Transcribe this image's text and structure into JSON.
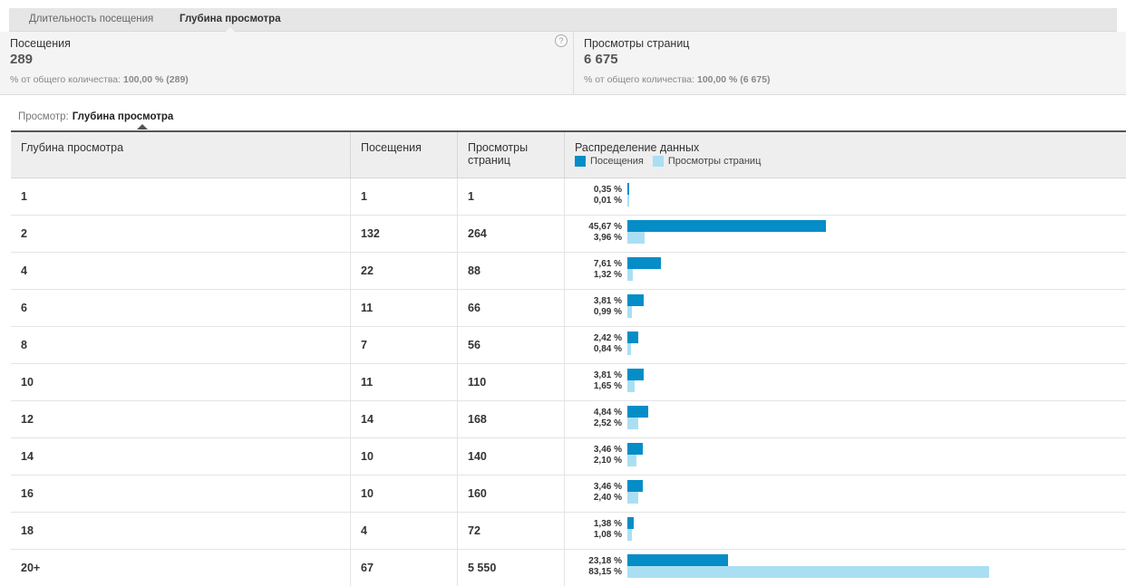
{
  "tabs": [
    {
      "label": "Длительность посещения"
    },
    {
      "label": "Глубина просмотра"
    }
  ],
  "scorecards": [
    {
      "title": "Посещения",
      "value": "289",
      "sub_prefix": "% от общего количества: ",
      "sub_value": "100,00 % (289)"
    },
    {
      "title": "Просмотры страниц",
      "value": "6 675",
      "sub_prefix": "% от общего количества: ",
      "sub_value": "100,00 % (6 675)"
    }
  ],
  "view": {
    "label": "Просмотр:",
    "value": "Глубина просмотра"
  },
  "table": {
    "headers": [
      "Глубина просмотра",
      "Посещения",
      "Просмотры страниц",
      "Распределение данных"
    ],
    "legend": [
      {
        "label": "Посещения",
        "color": "#058dc7"
      },
      {
        "label": "Просмотры страниц",
        "color": "#aadff3"
      }
    ],
    "rows": [
      {
        "depth": "1",
        "visits": "1",
        "views": "1",
        "visits_pct": "0,35 %",
        "views_pct": "0,01 %",
        "visits_share": 0.35,
        "views_share": 0.01
      },
      {
        "depth": "2",
        "visits": "132",
        "views": "264",
        "visits_pct": "45,67 %",
        "views_pct": "3,96 %",
        "visits_share": 45.67,
        "views_share": 3.96
      },
      {
        "depth": "4",
        "visits": "22",
        "views": "88",
        "visits_pct": "7,61 %",
        "views_pct": "1,32 %",
        "visits_share": 7.61,
        "views_share": 1.32
      },
      {
        "depth": "6",
        "visits": "11",
        "views": "66",
        "visits_pct": "3,81 %",
        "views_pct": "0,99 %",
        "visits_share": 3.81,
        "views_share": 0.99
      },
      {
        "depth": "8",
        "visits": "7",
        "views": "56",
        "visits_pct": "2,42 %",
        "views_pct": "0,84 %",
        "visits_share": 2.42,
        "views_share": 0.84
      },
      {
        "depth": "10",
        "visits": "11",
        "views": "110",
        "visits_pct": "3,81 %",
        "views_pct": "1,65 %",
        "visits_share": 3.81,
        "views_share": 1.65
      },
      {
        "depth": "12",
        "visits": "14",
        "views": "168",
        "visits_pct": "4,84 %",
        "views_pct": "2,52 %",
        "visits_share": 4.84,
        "views_share": 2.52
      },
      {
        "depth": "14",
        "visits": "10",
        "views": "140",
        "visits_pct": "3,46 %",
        "views_pct": "2,10 %",
        "visits_share": 3.46,
        "views_share": 2.1
      },
      {
        "depth": "16",
        "visits": "10",
        "views": "160",
        "visits_pct": "3,46 %",
        "views_pct": "2,40 %",
        "visits_share": 3.46,
        "views_share": 2.4
      },
      {
        "depth": "18",
        "visits": "4",
        "views": "72",
        "visits_pct": "1,38 %",
        "views_pct": "1,08 %",
        "visits_share": 1.38,
        "views_share": 1.08
      },
      {
        "depth": "20+",
        "visits": "67",
        "views": "5 550",
        "visits_pct": "23,18 %",
        "views_pct": "83,15 %",
        "visits_share": 23.18,
        "views_share": 83.15
      }
    ]
  }
}
